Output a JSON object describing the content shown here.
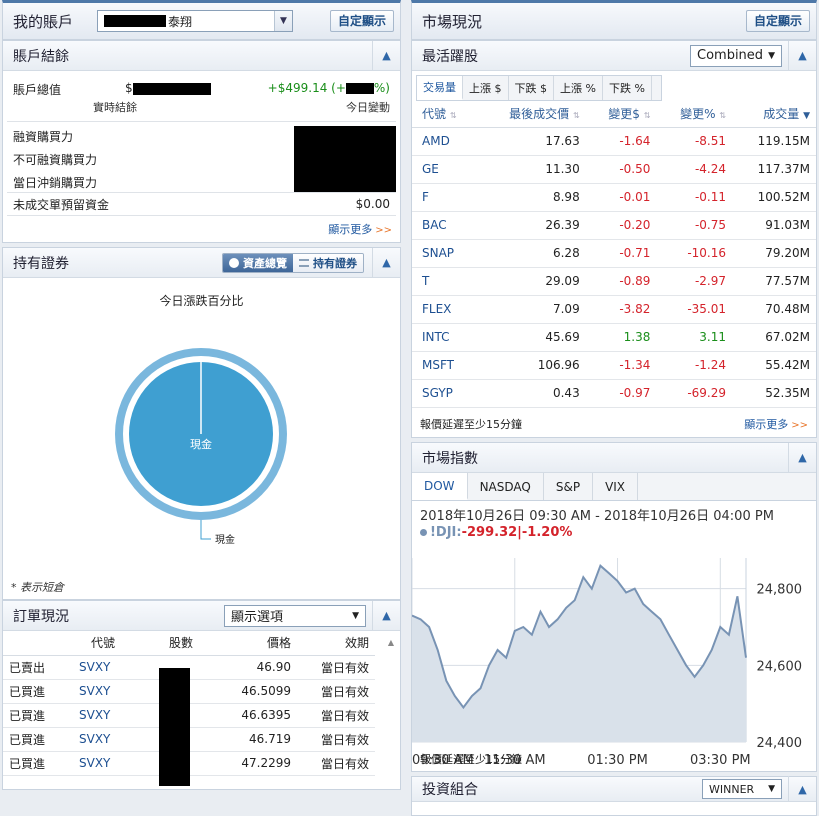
{
  "account": {
    "title": "我的賬戶",
    "name_suffix": "泰翔",
    "custom_btn": "自定顯示"
  },
  "summary": {
    "title": "賬戶結餘",
    "total_label": "賬戶總值",
    "total_prefix": "$",
    "change_value": "+$499.14 (+",
    "change_suffix": "%)",
    "realtime_label": "實時結餘",
    "today_change_label": "今日變動",
    "margin_bp": "融資購買力",
    "non_margin_bp": "不可融資購買力",
    "daytrade_bp": "當日沖銷購買力",
    "unsettled_label": "未成交單預留資金",
    "unsettled_value": "$0.00",
    "more": "顯示更多",
    "more_chev": ">>"
  },
  "holdings": {
    "title": "持有證券",
    "toggle_overview": "資產總覽",
    "toggle_holdings": "持有證券",
    "chart_title": "今日漲跌百分比",
    "center_label": "現金",
    "legend_label": "現金",
    "short_note": "* 表示短倉"
  },
  "orders": {
    "title": "訂單現況",
    "filter": "顯示選項",
    "headers": [
      "代號",
      "股數",
      "價格",
      "效期"
    ],
    "rows": [
      {
        "status": "已賣出",
        "symbol": "SVXY",
        "price": "46.90",
        "validity": "當日有效"
      },
      {
        "status": "已買進",
        "symbol": "SVXY",
        "price": "46.5099",
        "validity": "當日有效"
      },
      {
        "status": "已買進",
        "symbol": "SVXY",
        "price": "46.6395",
        "validity": "當日有效"
      },
      {
        "status": "已買進",
        "symbol": "SVXY",
        "price": "46.719",
        "validity": "當日有效"
      },
      {
        "status": "已買進",
        "symbol": "SVXY",
        "price": "47.2299",
        "validity": "當日有效"
      }
    ]
  },
  "market": {
    "title": "市場現況",
    "custom_btn": "自定顯示",
    "movers_title": "最活躍股",
    "combined": "Combined",
    "tabs": [
      "交易量",
      "上漲 $",
      "下跌 $",
      "上漲 %",
      "下跌 %"
    ],
    "headers": [
      "代號",
      "最後成交價",
      "變更$",
      "變更%",
      "成交量"
    ],
    "rows": [
      {
        "symbol": "AMD",
        "last": "17.63",
        "chg": "-1.64",
        "pct": "-8.51",
        "vol": "119.15M"
      },
      {
        "symbol": "GE",
        "last": "11.30",
        "chg": "-0.50",
        "pct": "-4.24",
        "vol": "117.37M"
      },
      {
        "symbol": "F",
        "last": "8.98",
        "chg": "-0.01",
        "pct": "-0.11",
        "vol": "100.52M"
      },
      {
        "symbol": "BAC",
        "last": "26.39",
        "chg": "-0.20",
        "pct": "-0.75",
        "vol": "91.03M"
      },
      {
        "symbol": "SNAP",
        "last": "6.28",
        "chg": "-0.71",
        "pct": "-10.16",
        "vol": "79.20M"
      },
      {
        "symbol": "T",
        "last": "29.09",
        "chg": "-0.89",
        "pct": "-2.97",
        "vol": "77.57M"
      },
      {
        "symbol": "FLEX",
        "last": "7.09",
        "chg": "-3.82",
        "pct": "-35.01",
        "vol": "70.48M"
      },
      {
        "symbol": "INTC",
        "last": "45.69",
        "chg": "1.38",
        "pct": "3.11",
        "vol": "67.02M"
      },
      {
        "symbol": "MSFT",
        "last": "106.96",
        "chg": "-1.34",
        "pct": "-1.24",
        "vol": "55.42M"
      },
      {
        "symbol": "SGYP",
        "last": "0.43",
        "chg": "-0.97",
        "pct": "-69.29",
        "vol": "52.35M"
      }
    ],
    "delay_note": "報價延遲至少15分鐘",
    "more": "顯示更多",
    "more_chev": ">>"
  },
  "indices": {
    "title": "市場指數",
    "tabs": [
      "DOW",
      "NASDAQ",
      "S&P",
      "VIX"
    ],
    "range": "2018年10月26日 09:30 AM - 2018年10月26日 04:00 PM",
    "ticker": "!DJI:",
    "change": "-299.32|-1.20%",
    "delay_note": "報價延遲至少15分鐘",
    "next_panel_title": "投資組合",
    "next_panel_select": "WINNER"
  },
  "chart_data": {
    "type": "area",
    "title": "",
    "xlabel": "",
    "ylabel": "",
    "x_ticks": [
      "09:30 AM",
      "11:30 AM",
      "01:30 PM",
      "03:30 PM"
    ],
    "y_ticks": [
      24400,
      24600,
      24800
    ],
    "ylim": [
      24400,
      24880
    ],
    "xlim": [
      0,
      390
    ],
    "series": [
      {
        "x": [
          0,
          10,
          20,
          30,
          40,
          50,
          60,
          70,
          80,
          90,
          100,
          110,
          120,
          130,
          140,
          150,
          160,
          170,
          180,
          190,
          200,
          210,
          220,
          230,
          240,
          250,
          260,
          270,
          280,
          290,
          300,
          310,
          320,
          330,
          340,
          350,
          360,
          370,
          380,
          390
        ],
        "values": [
          24730,
          24720,
          24700,
          24640,
          24560,
          24520,
          24490,
          24520,
          24540,
          24600,
          24640,
          24620,
          24690,
          24700,
          24680,
          24740,
          24700,
          24720,
          24750,
          24770,
          24830,
          24800,
          24860,
          24840,
          24820,
          24790,
          24800,
          24760,
          24740,
          24720,
          24680,
          24640,
          24600,
          24570,
          24600,
          24640,
          24700,
          24680,
          24780,
          24620
        ]
      }
    ]
  }
}
